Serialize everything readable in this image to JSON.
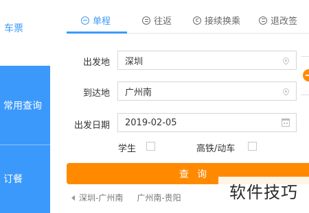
{
  "sidebar": {
    "top_label": "车票",
    "items": [
      {
        "label": "常用查询"
      },
      {
        "label": "订餐"
      }
    ]
  },
  "tabs": [
    {
      "label": "单程",
      "icon": "minus-circle-icon",
      "active": true
    },
    {
      "label": "往返",
      "icon": "equals-circle-icon",
      "active": false
    },
    {
      "label": "接续换乘",
      "icon": "transfer-circle-icon",
      "active": false
    },
    {
      "label": "退改签",
      "icon": "list-circle-icon",
      "active": false
    }
  ],
  "form": {
    "from": {
      "label": "出发地",
      "value": "深圳",
      "icon": "location-pin-icon"
    },
    "to": {
      "label": "到达地",
      "value": "广州南",
      "icon": "location-pin-icon"
    },
    "date": {
      "label": "出发日期",
      "value": "2019-02-05",
      "icon": "calendar-icon"
    },
    "student": {
      "label": "学生",
      "checked": false
    },
    "highspeed": {
      "label": "高铁/动车",
      "checked": false
    }
  },
  "query_button": {
    "label": "查询"
  },
  "history": [
    "深圳-广州南",
    "广州南-贵阳"
  ],
  "watermark": "软件技巧",
  "colors": {
    "accent_blue": "#3b99fc",
    "accent_orange": "#ff8a00"
  }
}
